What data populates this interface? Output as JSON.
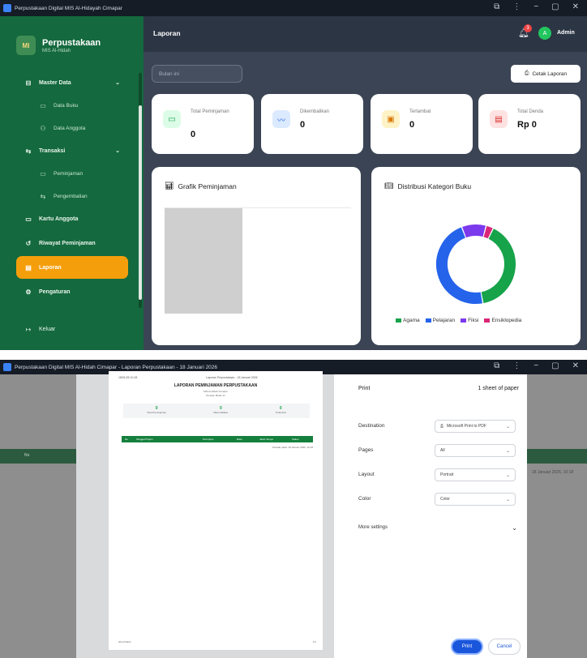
{
  "window1": {
    "title": "Perpustakaan Digital MIS Al-Hidayah Cimapar",
    "controls": [
      "⧉",
      "⋮",
      "−",
      "▢",
      "✕"
    ]
  },
  "sidebar": {
    "brand_logo": "MI",
    "brand_title": "Perpustakaan",
    "brand_sub": "MIS Al-Hidah",
    "items": [
      {
        "label": "Master Data",
        "icon": "database-icon"
      },
      {
        "label": "Data Buku",
        "icon": "book-icon"
      },
      {
        "label": "Data Anggota",
        "icon": "users-icon"
      },
      {
        "label": "Transaksi",
        "icon": "swap-icon"
      },
      {
        "label": "Peminjaman",
        "icon": "book-out-icon"
      },
      {
        "label": "Pengembalian",
        "icon": "return-icon"
      },
      {
        "label": "Kartu Anggota",
        "icon": "card-icon"
      },
      {
        "label": "Riwayat Peminjaman",
        "icon": "history-icon"
      },
      {
        "label": "Laporan",
        "icon": "report-icon"
      },
      {
        "label": "Pengaturan",
        "icon": "gear-icon"
      },
      {
        "label": "Keluar",
        "icon": "logout-icon"
      }
    ]
  },
  "topbar": {
    "title": "Laporan",
    "notif_count": "3",
    "admin_initial": "A",
    "admin_name": "Admin"
  },
  "filters": {
    "month_select": "Bulan ini",
    "print_button": "Cetak Laporan"
  },
  "stats": [
    {
      "label": "Total Peminjaman",
      "value": "0",
      "icon": "book-icon",
      "color": "#dcfce7",
      "fg": "#16a34a"
    },
    {
      "label": "Dikembalikan",
      "value": "0",
      "icon": "trend-icon",
      "color": "#dbeafe",
      "fg": "#2563eb"
    },
    {
      "label": "Terlambat",
      "value": "0",
      "icon": "calendar-icon",
      "color": "#fef3c7",
      "fg": "#d97706"
    },
    {
      "label": "Total Denda",
      "value": "Rp 0",
      "icon": "receipt-icon",
      "color": "#fee2e2",
      "fg": "#dc2626"
    }
  ],
  "card_borrow": {
    "title": "Grafik Peminjaman"
  },
  "card_dist": {
    "title": "Distribusi Kategori Buku",
    "legend": [
      "Agama",
      "Pelajaran",
      "Fiksi",
      "Ensiklopedia"
    ]
  },
  "chart_data": {
    "type": "pie",
    "categories": [
      "Agama",
      "Pelajaran",
      "Fiksi",
      "Ensiklopedia"
    ],
    "values": [
      40,
      47,
      10,
      3
    ],
    "colors": [
      "#16a34a",
      "#2563eb",
      "#7c3aed",
      "#db2777"
    ],
    "title": "Distribusi Kategori Buku",
    "legend_position": "bottom"
  },
  "window2": {
    "title": "Perpustakaan Digital MIS Al-Hidah Cimapar - Laporan Perpustakaan - 18 Januari 2026"
  },
  "print_preview": {
    "head_left": "18/01/26 10:18",
    "head_right": "Laporan Perpustakaan - 18 Januari 2026",
    "doc_title": "LAPORAN PEMINJAMAN PERPUSTAKAAN",
    "sub1": "MIS Al-Hidah Cimapar",
    "sub2": "Periode: Bulan ini",
    "stats": [
      {
        "value": "0",
        "label": "Total Peminjaman"
      },
      {
        "value": "0",
        "label": "Dikembalikan"
      },
      {
        "value": "0",
        "label": "Terlambat"
      }
    ],
    "columns": [
      "No",
      "Tanggal Pinjam",
      "Peminjam",
      "Buku",
      "Jatuh Tempo",
      "Status"
    ],
    "note": "Dicetak pada: 18 Januari 2026, 10:18",
    "foot_left": "about:blank",
    "foot_right": "1/1"
  },
  "bg_page": {
    "date": "18 Januari 2026, 10:18",
    "band_label": "No"
  },
  "print_dialog": {
    "title": "Print",
    "sheets": "1 sheet of paper",
    "rows": [
      {
        "label": "Destination",
        "value": "Microsoft Print to PDF",
        "icon": "printer-icon"
      },
      {
        "label": "Pages",
        "value": "All"
      },
      {
        "label": "Layout",
        "value": "Portrait"
      },
      {
        "label": "Color",
        "value": "Color"
      }
    ],
    "more_settings": "More settings",
    "print_button": "Print",
    "cancel_button": "Cancel"
  }
}
